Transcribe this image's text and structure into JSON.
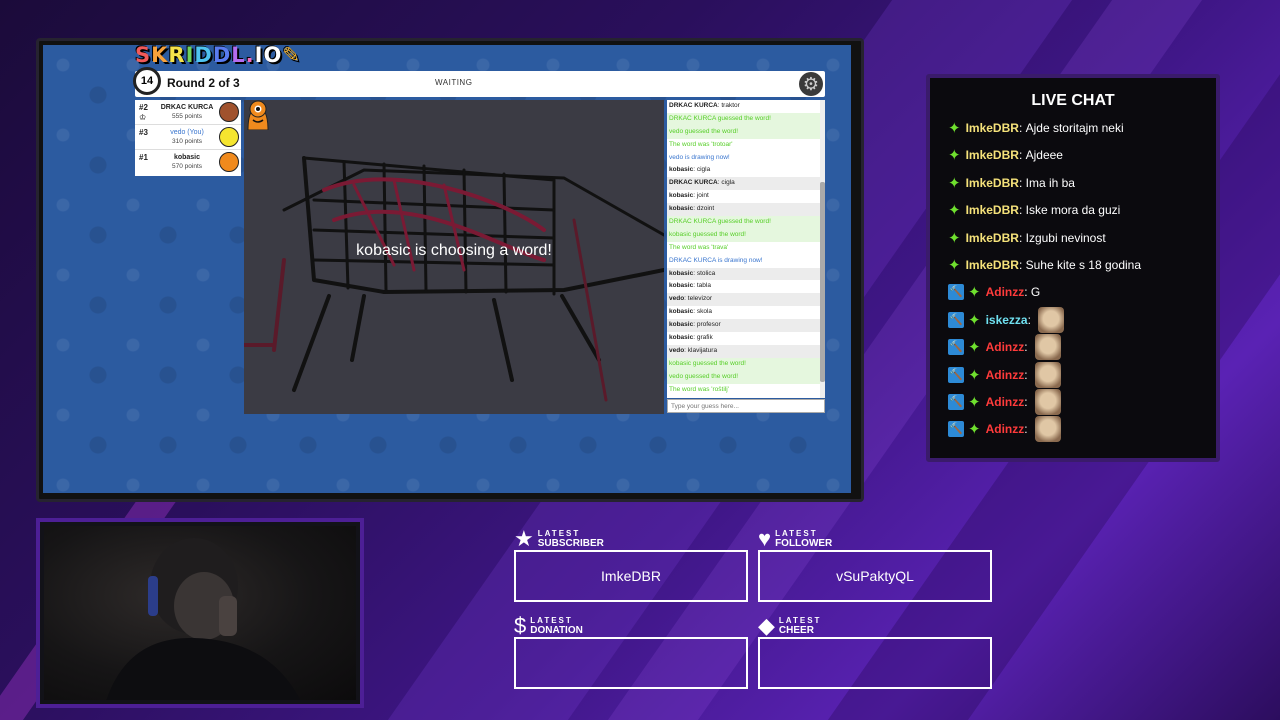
{
  "colors": {
    "accent_purple": "#4d1f96",
    "green_msg": "#56ce27",
    "blue_msg": "#3975ce",
    "mod_blue": "#2d8ad6",
    "chat_user_yellow": "#f5e27a",
    "chat_user_red": "#ff3b3b",
    "chat_user_cyan": "#6fe0f0"
  },
  "game": {
    "logo": [
      "S",
      "K",
      "R",
      "I",
      "D",
      "D",
      "L",
      ".",
      "I",
      "O"
    ],
    "timer": "14",
    "round": "Round 2 of 3",
    "status": "WAITING",
    "settings_icon": "gear-icon",
    "overlay": "kobasic is choosing a word!",
    "guess_placeholder": "Type your guess here...",
    "players": [
      {
        "rank": "#2",
        "name": "DRKAC KURCA",
        "points": "555 points",
        "color": "#a0522d"
      },
      {
        "rank": "#3",
        "name": "vedo (You)",
        "points": "310 points",
        "color": "#f5e52f"
      },
      {
        "rank": "#1",
        "name": "kobasic",
        "points": "570 points",
        "color": "#f08a1d"
      }
    ],
    "chat": [
      {
        "user": "DRKAC KURCA",
        "text": "traktor",
        "type": "normal"
      },
      {
        "user": "",
        "text": "DRKAC KURCA guessed the word!",
        "type": "green"
      },
      {
        "user": "",
        "text": "vedo guessed the word!",
        "type": "green"
      },
      {
        "user": "",
        "text": "The word was 'trotoar'",
        "type": "green"
      },
      {
        "user": "",
        "text": "vedo is drawing now!",
        "type": "blue"
      },
      {
        "user": "kobasic",
        "text": "cigla",
        "type": "normal"
      },
      {
        "user": "DRKAC KURCA",
        "text": "cigla",
        "type": "alt"
      },
      {
        "user": "kobasic",
        "text": "joint",
        "type": "normal"
      },
      {
        "user": "kobasic",
        "text": "dzoint",
        "type": "alt"
      },
      {
        "user": "",
        "text": "DRKAC KURCA guessed the word!",
        "type": "green"
      },
      {
        "user": "",
        "text": "kobasic guessed the word!",
        "type": "green"
      },
      {
        "user": "",
        "text": "The word was 'trava'",
        "type": "green"
      },
      {
        "user": "",
        "text": "DRKAC KURCA is drawing now!",
        "type": "blue"
      },
      {
        "user": "kobasic",
        "text": "stolica",
        "type": "alt"
      },
      {
        "user": "kobasic",
        "text": "tabla",
        "type": "normal"
      },
      {
        "user": "vedo",
        "text": "televizor",
        "type": "alt"
      },
      {
        "user": "kobasic",
        "text": "skola",
        "type": "normal"
      },
      {
        "user": "kobasic",
        "text": "profesor",
        "type": "alt"
      },
      {
        "user": "kobasic",
        "text": "grafik",
        "type": "normal"
      },
      {
        "user": "vedo",
        "text": "klavijatura",
        "type": "alt"
      },
      {
        "user": "",
        "text": "kobasic guessed the word!",
        "type": "green"
      },
      {
        "user": "",
        "text": "vedo guessed the word!",
        "type": "green"
      },
      {
        "user": "",
        "text": "The word was 'roštilj'",
        "type": "green"
      }
    ]
  },
  "livechat": {
    "title": "LIVE CHAT",
    "messages": [
      {
        "mod": false,
        "user": "ImkeDBR",
        "text": "Ajde storitajm neki",
        "user_color": "#f5e27a",
        "emote": false
      },
      {
        "mod": false,
        "user": "ImkeDBR",
        "text": "Ajdeee",
        "user_color": "#f5e27a",
        "emote": false
      },
      {
        "mod": false,
        "user": "ImkeDBR",
        "text": "Ima ih ba",
        "user_color": "#f5e27a",
        "emote": false
      },
      {
        "mod": false,
        "user": "ImkeDBR",
        "text": "Iske mora da guzi",
        "user_color": "#f5e27a",
        "emote": false
      },
      {
        "mod": false,
        "user": "ImkeDBR",
        "text": "Izgubi nevinost",
        "user_color": "#f5e27a",
        "emote": false
      },
      {
        "mod": false,
        "user": "ImkeDBR",
        "text": "Suhe kite s 18 godina",
        "user_color": "#f5e27a",
        "emote": false
      },
      {
        "mod": true,
        "user": "Adinzz",
        "text": "G",
        "user_color": "#ff3b3b",
        "emote": false
      },
      {
        "mod": true,
        "user": "iskezza",
        "text": "",
        "user_color": "#6fe0f0",
        "emote": true
      },
      {
        "mod": true,
        "user": "Adinzz",
        "text": "",
        "user_color": "#ff3b3b",
        "emote": true
      },
      {
        "mod": true,
        "user": "Adinzz",
        "text": "",
        "user_color": "#ff3b3b",
        "emote": true
      },
      {
        "mod": true,
        "user": "Adinzz",
        "text": "",
        "user_color": "#ff3b3b",
        "emote": true
      },
      {
        "mod": true,
        "user": "Adinzz",
        "text": "",
        "user_color": "#ff3b3b",
        "emote": true
      }
    ]
  },
  "overlay": {
    "subscriber": {
      "label_top": "LATEST",
      "label": "SUBSCRIBER",
      "icon": "star-icon",
      "value": "ImkeDBR"
    },
    "follower": {
      "label_top": "LATEST",
      "label": "FOLLOWER",
      "icon": "heart-icon",
      "value": "vSuPaktyQL"
    },
    "donation": {
      "label_top": "LATEST",
      "label": "DONATION",
      "icon": "dollar-icon",
      "value": ""
    },
    "cheer": {
      "label_top": "LATEST",
      "label": "CHEER",
      "icon": "diamond-icon",
      "value": ""
    }
  }
}
